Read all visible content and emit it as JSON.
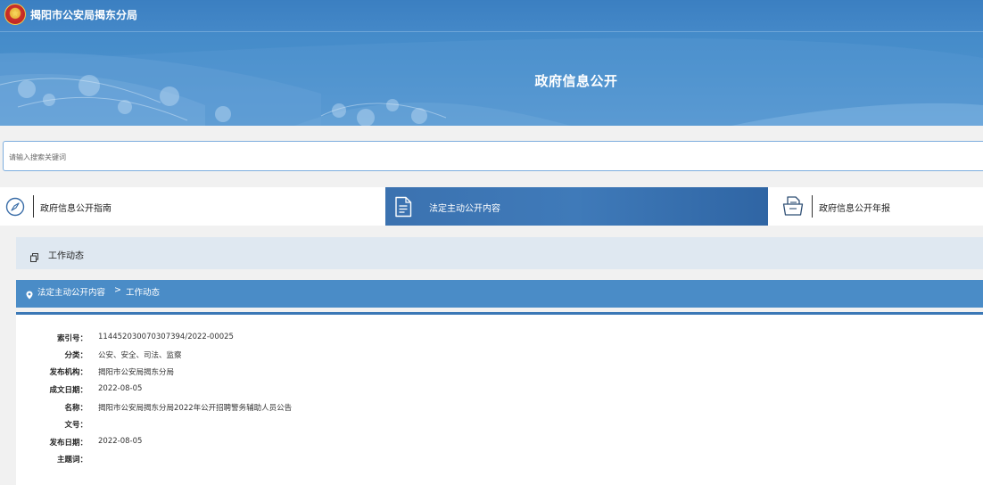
{
  "header": {
    "site_name": "揭阳市公安局揭东分局",
    "banner_title": "政府信息公开",
    "colors": {
      "banner": "#4a90cc",
      "accent": "#3b78b6",
      "nav_active": "#3f7ab9"
    }
  },
  "search": {
    "placeholder": "请输入搜索关键词",
    "value": ""
  },
  "nav": {
    "items": [
      {
        "label": "政府信息公开指南",
        "icon": "compass-icon",
        "active": false
      },
      {
        "label": "法定主动公开内容",
        "icon": "document-list-icon",
        "active": true
      },
      {
        "label": "政府信息公开年报",
        "icon": "report-files-icon",
        "active": false
      }
    ]
  },
  "section": {
    "title": "工作动态",
    "icon": "copy-icon"
  },
  "breadcrumb": {
    "icon": "location-pin-icon",
    "parent": "法定主动公开内容",
    "separator": ">",
    "current": "工作动态"
  },
  "detail": {
    "fields": [
      {
        "key": "索引号：",
        "value": "11445203007030739​4/2022-00025"
      },
      {
        "key": "分类：",
        "value": "公安、安全、司法、监察"
      },
      {
        "key": "发布机构：",
        "value": "揭阳市公安局揭东分局"
      },
      {
        "key": "成文日期：",
        "value": "2022-08-05"
      },
      {
        "key": "名称：",
        "value": "揭阳市公安局揭东分局2022年公开招聘警务辅助人员公告"
      },
      {
        "key": "文号：",
        "value": ""
      },
      {
        "key": "发布日期：",
        "value": "2022-08-05"
      },
      {
        "key": "主题词：",
        "value": ""
      }
    ]
  }
}
